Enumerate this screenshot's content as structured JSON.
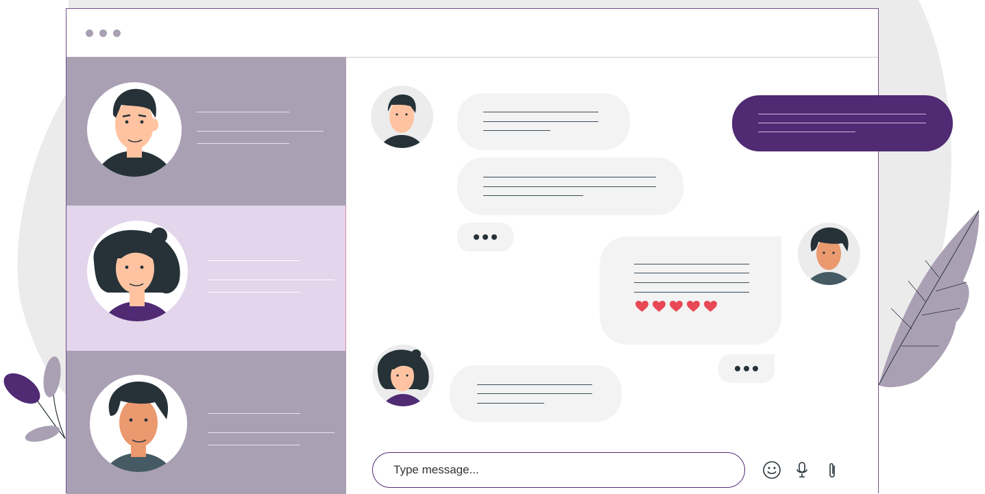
{
  "window": {
    "controls": [
      "dot",
      "dot",
      "dot"
    ]
  },
  "composer": {
    "placeholder": "Type message..."
  },
  "icons": {
    "emoji": "smiley-icon",
    "mic": "microphone-icon",
    "attach": "paperclip-icon",
    "typing": "typing-indicator-dots",
    "reaction": "heart-icon"
  },
  "reactions": {
    "hearts_count": 5
  },
  "colors": {
    "accent": "#502a73",
    "sidebar": "#aaa0b4",
    "sidebar_active": "#e2d5ec",
    "bubble": "#f3f3f3",
    "heart": "#e84855",
    "skin_light": "#ffc3a1",
    "skin_tan": "#eb996e",
    "hair": "#263238"
  }
}
